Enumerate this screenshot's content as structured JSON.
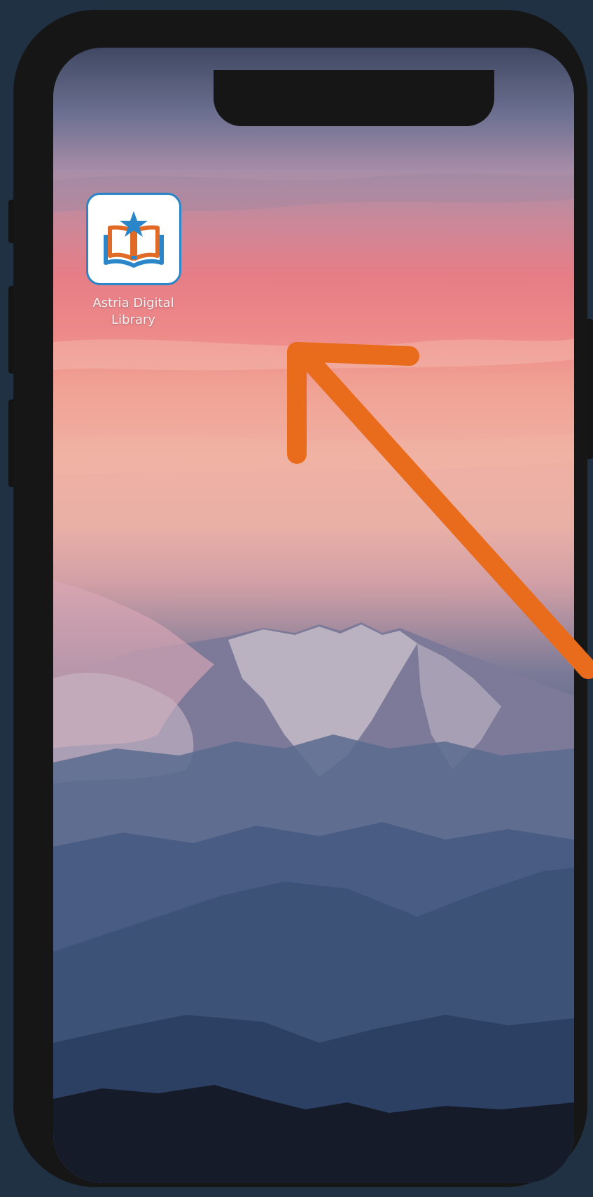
{
  "home_screen": {
    "apps": [
      {
        "label": "Astria Digital Library",
        "icon": "astria-library-icon"
      }
    ]
  },
  "colors": {
    "frame_background": "#1f3142",
    "phone_body": "#161616",
    "annotation_arrow": "#e96c1d",
    "icon_border": "#2a86c8",
    "icon_book_orange": "#e06a26",
    "icon_book_blue": "#2a86c8"
  }
}
